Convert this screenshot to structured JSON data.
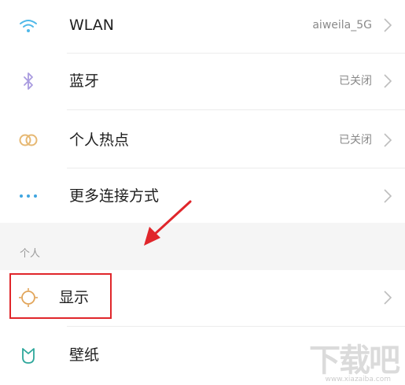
{
  "settings": {
    "items": [
      {
        "label": "WLAN",
        "value": "aiweila_5G",
        "icon": "wifi-icon"
      },
      {
        "label": "蓝牙",
        "value": "已关闭",
        "icon": "bluetooth-icon"
      },
      {
        "label": "个人热点",
        "value": "已关闭",
        "icon": "hotspot-icon"
      },
      {
        "label": "更多连接方式",
        "value": "",
        "icon": "more-dots-icon"
      }
    ],
    "section_personal": "个人",
    "personal_items": [
      {
        "label": "显示",
        "icon": "display-sun-icon"
      },
      {
        "label": "壁纸",
        "icon": "wallpaper-icon"
      }
    ]
  },
  "watermark": {
    "text": "下载吧",
    "sub": "www.xiazaiba.com"
  },
  "colors": {
    "accent_red": "#e0262b",
    "wifi_blue": "#4fb8e8",
    "bt_purple": "#a99bdf",
    "hotspot_orange": "#e6b873",
    "dots_blue": "#3fa5e0",
    "display_orange": "#e2a55a",
    "wallpaper_teal": "#2ea79b"
  }
}
